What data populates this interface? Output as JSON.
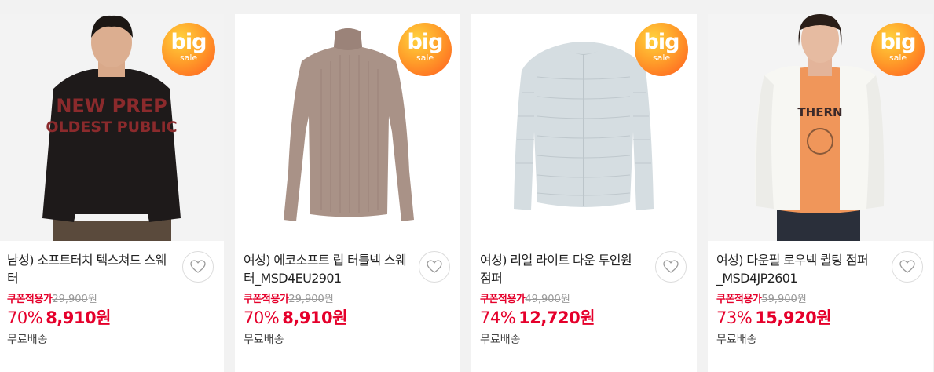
{
  "colors": {
    "accent": "#e5002b",
    "badge_start": "#ffd23d",
    "badge_end": "#ff5a1f"
  },
  "products": [
    {
      "title": "남성) 소프트터치 텍스쳐드 스웨터",
      "badge_main": "big",
      "badge_sub": "sale",
      "coupon_label": "쿠폰적용가",
      "original_price": "29,900",
      "original_unit": "원",
      "discount": "70%",
      "price": "8,910",
      "unit": "원",
      "shipping": "무료배송",
      "print_line1": "NEW PREP",
      "print_line2": "OLDEST PUBLIC"
    },
    {
      "title": "여성) 에코소프트 립 터틀넥 스웨터_MSD4EU2901",
      "badge_main": "big",
      "badge_sub": "sale",
      "coupon_label": "쿠폰적용가",
      "original_price": "29,900",
      "original_unit": "원",
      "discount": "70%",
      "price": "8,910",
      "unit": "원",
      "shipping": "무료배송"
    },
    {
      "title": "여성) 리얼 라이트 다운 투인원 점퍼",
      "badge_main": "big",
      "badge_sub": "sale",
      "coupon_label": "쿠폰적용가",
      "original_price": "49,900",
      "original_unit": "원",
      "discount": "74%",
      "price": "12,720",
      "unit": "원",
      "shipping": "무료배송"
    },
    {
      "title": "여성) 다운필 로우넥 퀼팅 점퍼_MSD4JP2601",
      "badge_main": "big",
      "badge_sub": "sale",
      "coupon_label": "쿠폰적용가",
      "original_price": "59,900",
      "original_unit": "원",
      "discount": "73%",
      "price": "15,920",
      "unit": "원",
      "shipping": "무료배송",
      "print_line1": "THERN"
    }
  ]
}
